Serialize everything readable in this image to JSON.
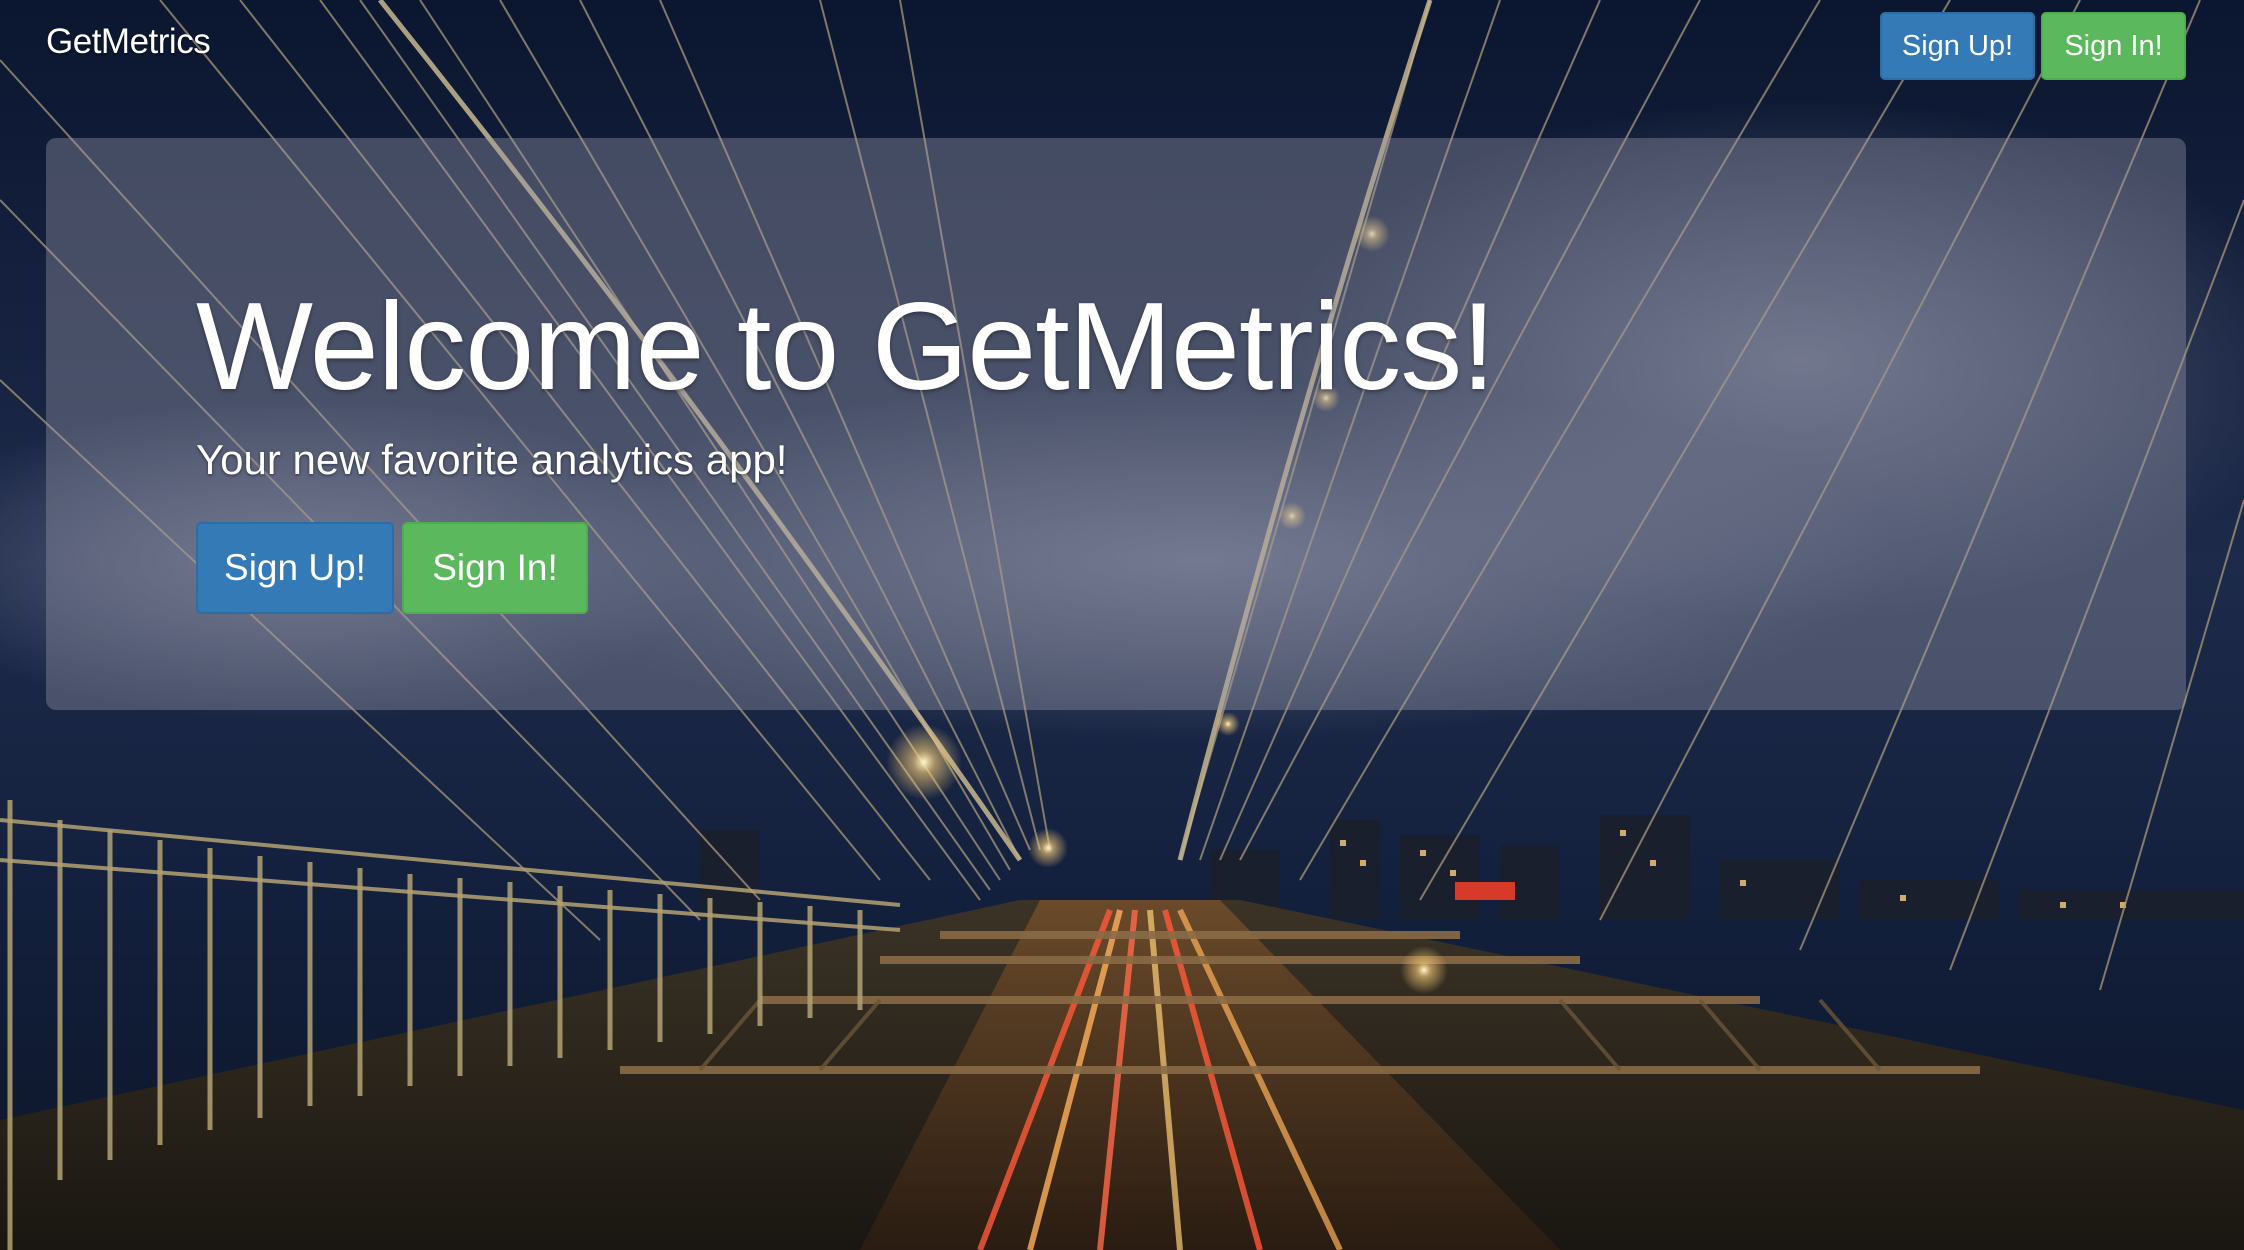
{
  "navbar": {
    "brand": "GetMetrics",
    "signup_label": "Sign Up!",
    "signin_label": "Sign In!"
  },
  "hero": {
    "title": "Welcome to GetMetrics!",
    "subtitle": "Your new favorite analytics app!",
    "signup_label": "Sign Up!",
    "signin_label": "Sign In!"
  },
  "background": {
    "description_icon": "bridge-night-photo"
  },
  "colors": {
    "primary": "#337ab7",
    "success": "#5cb85c",
    "panel_overlay": "rgba(155,155,170,0.38)",
    "sky": "#0e1a33"
  }
}
